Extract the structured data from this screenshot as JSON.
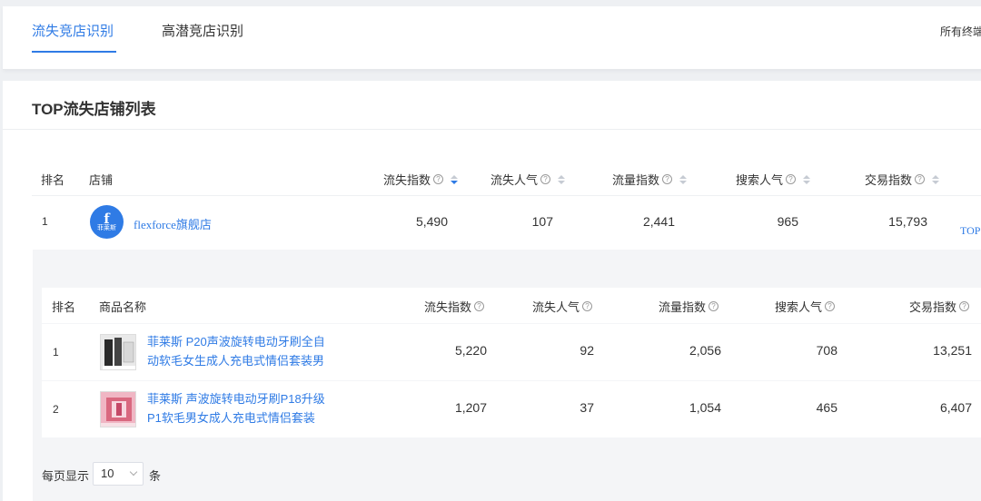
{
  "tabs": [
    {
      "label": "流失竞店识别",
      "active": true
    },
    {
      "label": "高潜竞店识别",
      "active": false
    }
  ],
  "terminal_label": "所有终端",
  "section_title": "TOP流失店铺列表",
  "store_table": {
    "headers": {
      "rank": "排名",
      "store": "店铺",
      "loss_index": "流失指数",
      "loss_popularity": "流失人气",
      "traffic_index": "流量指数",
      "search_popularity": "搜索人气",
      "trade_index": "交易指数"
    },
    "rows": [
      {
        "rank": "1",
        "store_name": "flexforce旗舰店",
        "logo_glyph": "f",
        "logo_text": "菲莱斯",
        "loss_index": "5,490",
        "loss_popularity": "107",
        "traffic_index": "2,441",
        "search_popularity": "965",
        "trade_index": "15,793",
        "action": "TOP"
      }
    ]
  },
  "product_table": {
    "headers": {
      "rank": "排名",
      "name": "商品名称",
      "loss_index": "流失指数",
      "loss_popularity": "流失人气",
      "traffic_index": "流量指数",
      "search_popularity": "搜索人气",
      "trade_index": "交易指数"
    },
    "rows": [
      {
        "rank": "1",
        "name": "菲莱斯 P20声波旋转电动牙刷全自动软毛女生成人充电式情侣套装男",
        "loss_index": "5,220",
        "loss_popularity": "92",
        "traffic_index": "2,056",
        "search_popularity": "708",
        "trade_index": "13,251"
      },
      {
        "rank": "2",
        "name": "菲莱斯 声波旋转电动牙刷P18升级P1软毛男女成人充电式情侣套装",
        "loss_index": "1,207",
        "loss_popularity": "37",
        "traffic_index": "1,054",
        "search_popularity": "465",
        "trade_index": "6,407"
      }
    ]
  },
  "pager": {
    "prefix": "每页显示",
    "page_size": "10",
    "suffix": "条"
  },
  "colors": {
    "accent": "#2f7be5",
    "text": "#333333",
    "background": "#eef0f3"
  }
}
